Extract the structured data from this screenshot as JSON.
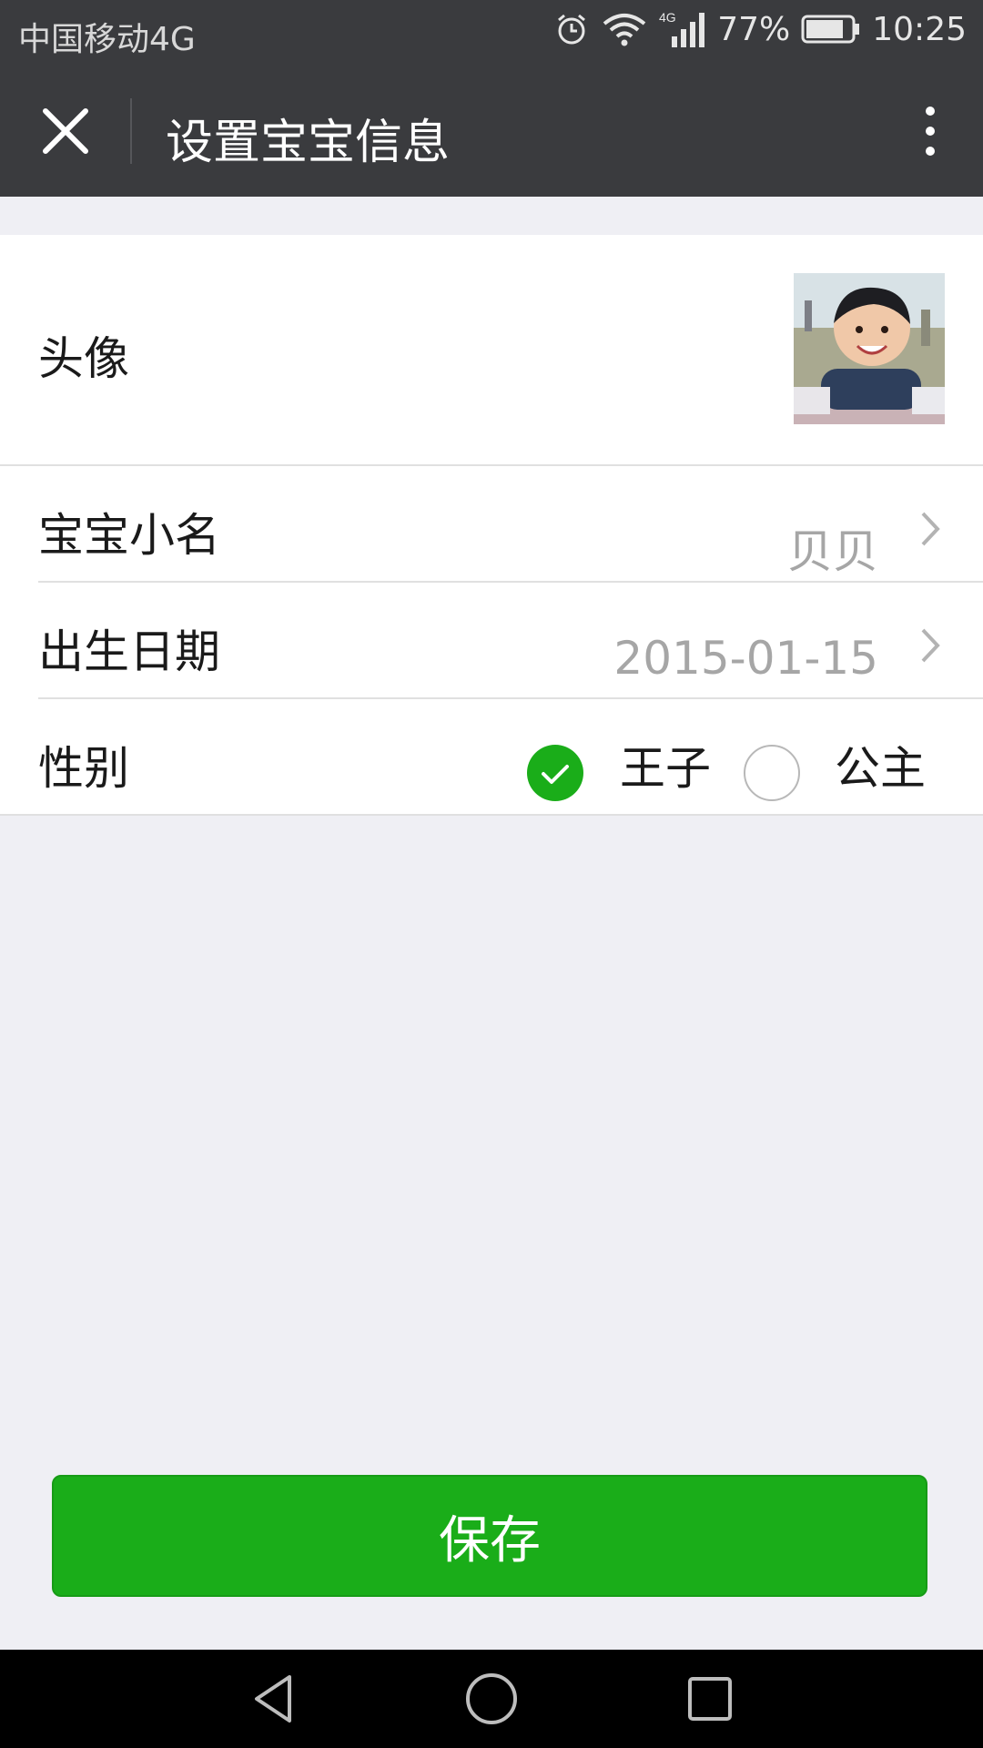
{
  "status_bar": {
    "carrier": "中国移动4G",
    "network": "4G",
    "battery": "77%",
    "time": "10:25",
    "icons": [
      "alarm-icon",
      "wifi-icon",
      "cellular-signal-icon",
      "battery-icon"
    ]
  },
  "nav": {
    "title": "设置宝宝信息",
    "close_icon": "close-icon",
    "more_icon": "more-vertical-icon"
  },
  "form": {
    "avatar_label": "头像",
    "nickname_label": "宝宝小名",
    "nickname_value": "贝贝",
    "birthdate_label": "出生日期",
    "birthdate_value": "2015-01-15",
    "gender_label": "性别",
    "gender_options": [
      {
        "label": "王子",
        "selected": true
      },
      {
        "label": "公主",
        "selected": false
      }
    ]
  },
  "save_button": "保存",
  "colors": {
    "accent": "#1aad19",
    "header": "#3a3b3e",
    "background": "#efeff4"
  }
}
